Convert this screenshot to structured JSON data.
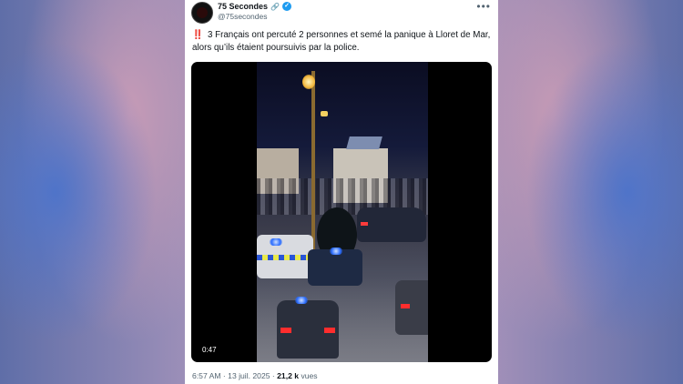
{
  "tweet": {
    "author_name": "75 Secondes",
    "author_emoji": "🔗",
    "handle": "@75secondes",
    "more_icon": "more-horizontal-icon",
    "alert_emoji": "‼️",
    "text": "3 Français ont percuté 2 personnes et semé la panique à Lloret de Mar, alors qu’ils étaient poursuivis par la police.",
    "video_duration": "0:47",
    "timestamp": "6:57 AM · 13 juil. 2025 · ",
    "views_count": "21,2 k",
    "views_label": " vues"
  },
  "colors": {
    "verified": "#1d9bf0",
    "text_primary": "#0f1419",
    "text_secondary": "#536471"
  }
}
